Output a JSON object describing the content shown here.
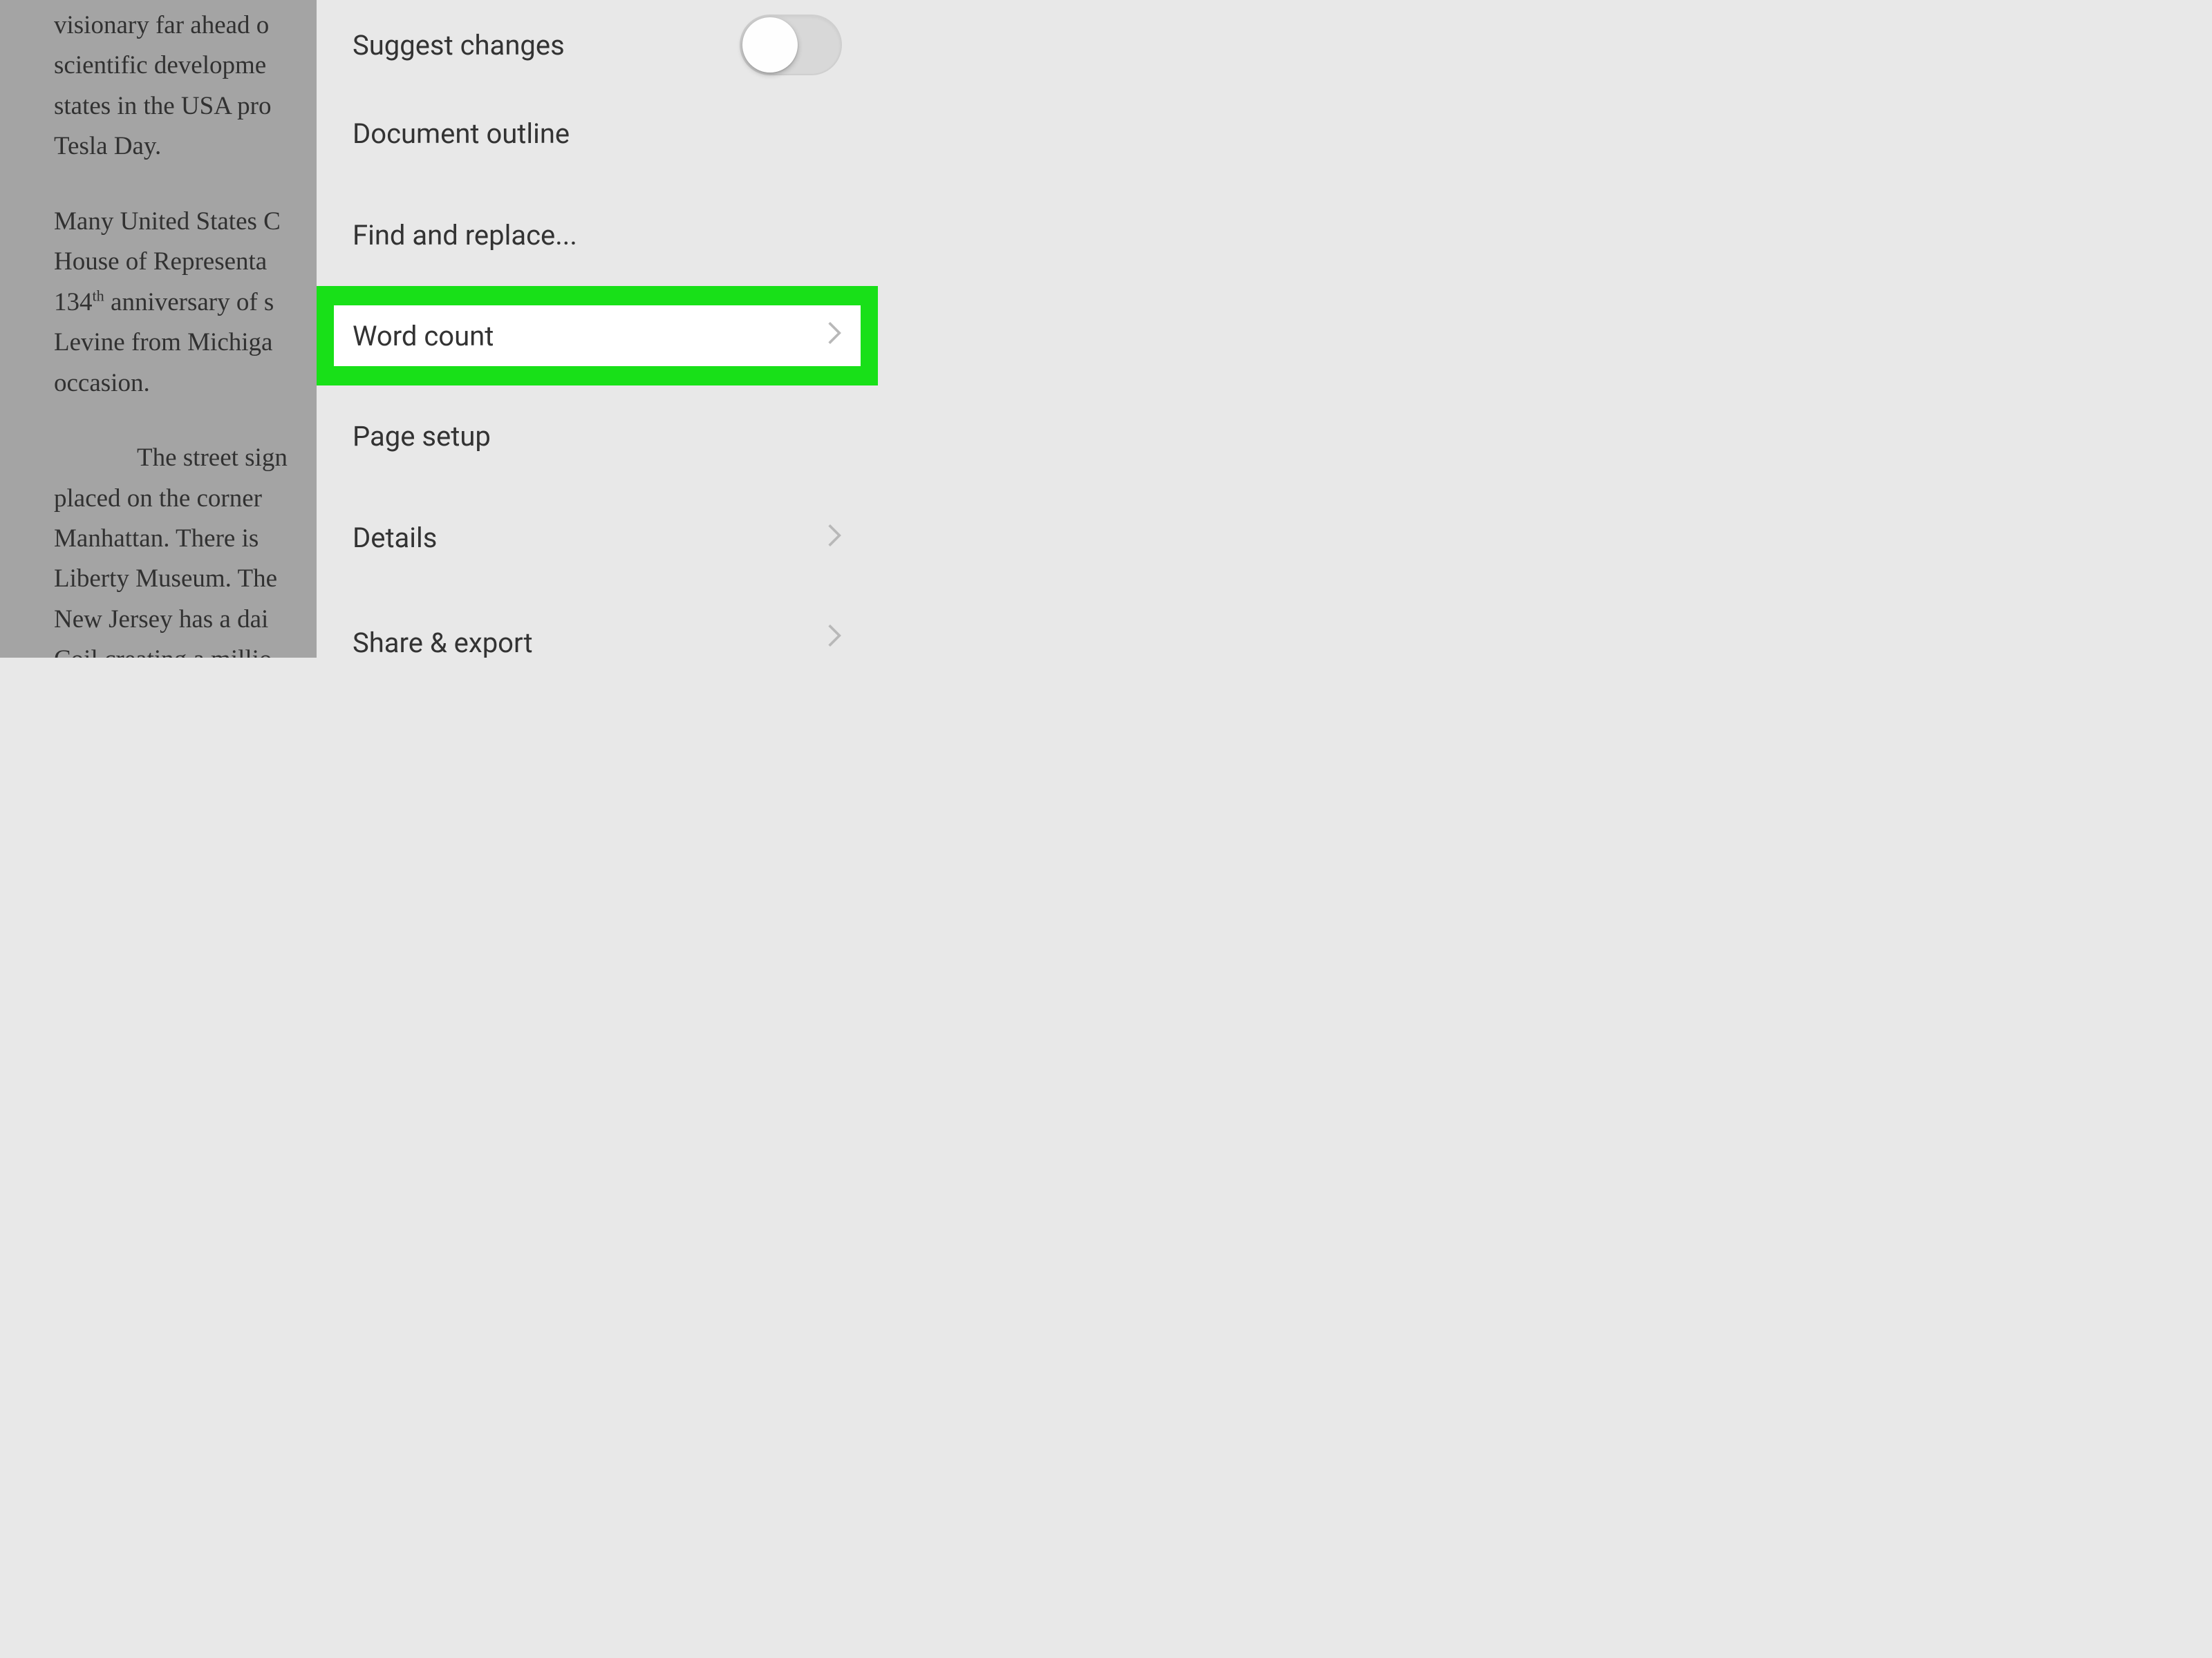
{
  "document": {
    "paragraph1_line1": "visionary far ahead o",
    "paragraph1_line2": "scientific developme",
    "paragraph1_line3": "states in the USA pro",
    "paragraph1_line4": "Tesla Day.",
    "paragraph2_line1": "Many United States C",
    "paragraph2_line2": "House of Representa",
    "paragraph2_line3a": "134",
    "paragraph2_line3sup": "th",
    "paragraph2_line3b": " anniversary of s",
    "paragraph2_line4": "Levine from Michiga",
    "paragraph2_line5": "occasion.",
    "paragraph3_line1": "The street sign",
    "paragraph3_line2": "placed on the corner",
    "paragraph3_line3": "Manhattan. There is ",
    "paragraph3_line4": "Liberty Museum. The",
    "paragraph3_line5": "New Jersey has a dai",
    "paragraph3_line6": "Coil creating a millio"
  },
  "menu": {
    "suggest_changes": {
      "label": "Suggest changes",
      "toggled": false
    },
    "document_outline": {
      "label": "Document outline"
    },
    "find_replace": {
      "label": "Find and replace..."
    },
    "word_count": {
      "label": "Word count"
    },
    "page_setup": {
      "label": "Page setup"
    },
    "details": {
      "label": "Details"
    },
    "share_export": {
      "label": "Share & export"
    }
  }
}
